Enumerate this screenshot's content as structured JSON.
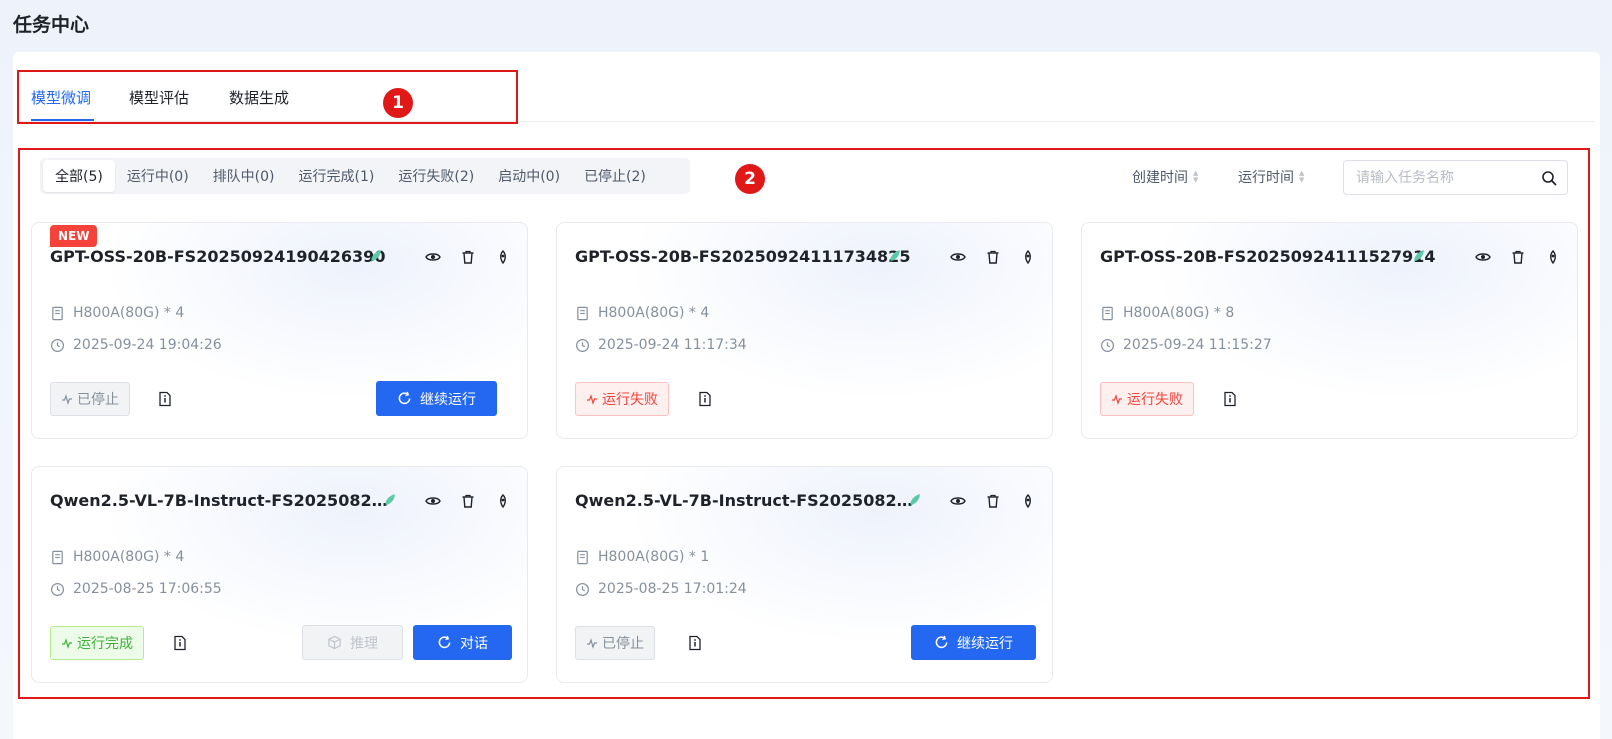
{
  "page_title": "任务中心",
  "tabs": [
    {
      "label": "模型微调",
      "active": true
    },
    {
      "label": "模型评估",
      "active": false
    },
    {
      "label": "数据生成",
      "active": false
    }
  ],
  "annotations": [
    "1",
    "2"
  ],
  "filters": [
    {
      "label": "全部(5)",
      "active": true
    },
    {
      "label": "运行中(0)",
      "active": false
    },
    {
      "label": "排队中(0)",
      "active": false
    },
    {
      "label": "运行完成(1)",
      "active": false
    },
    {
      "label": "运行失败(2)",
      "active": false
    },
    {
      "label": "启动中(0)",
      "active": false
    },
    {
      "label": "已停止(2)",
      "active": false
    }
  ],
  "sort": {
    "created": "创建时间",
    "runtime": "运行时间"
  },
  "search": {
    "placeholder": "请输入任务名称",
    "value": ""
  },
  "cards": [
    {
      "new_tag": "NEW",
      "title": "GPT-OSS-20B-FS20250924190426390",
      "gpu": "H800A(80G) * 4",
      "time": "2025-09-24 19:04:26",
      "status": "已停止",
      "status_type": "stopped",
      "primary_button": "继续运行"
    },
    {
      "title": "GPT-OSS-20B-FS20250924111734825",
      "gpu": "H800A(80G) * 4",
      "time": "2025-09-24 11:17:34",
      "status": "运行失败",
      "status_type": "failed"
    },
    {
      "title": "GPT-OSS-20B-FS20250924111527914",
      "gpu": "H800A(80G) * 8",
      "time": "2025-09-24 11:15:27",
      "status": "运行失败",
      "status_type": "failed"
    },
    {
      "title": "Qwen2.5-VL-7B-Instruct-FS20250825...",
      "gpu": "H800A(80G) * 4",
      "time": "2025-08-25 17:06:55",
      "status": "运行完成",
      "status_type": "done",
      "secondary_button": "推理",
      "primary_button": "对话"
    },
    {
      "title": "Qwen2.5-VL-7B-Instruct-FS20250825...",
      "gpu": "H800A(80G) * 1",
      "time": "2025-08-25 17:01:24",
      "status": "已停止",
      "status_type": "stopped",
      "primary_button": "继续运行"
    }
  ],
  "colors": {
    "accent": "#2468f2",
    "annotation": "#e01818",
    "failed": "#f5433b",
    "done": "#3fb13c",
    "stopped": "#86909c"
  }
}
